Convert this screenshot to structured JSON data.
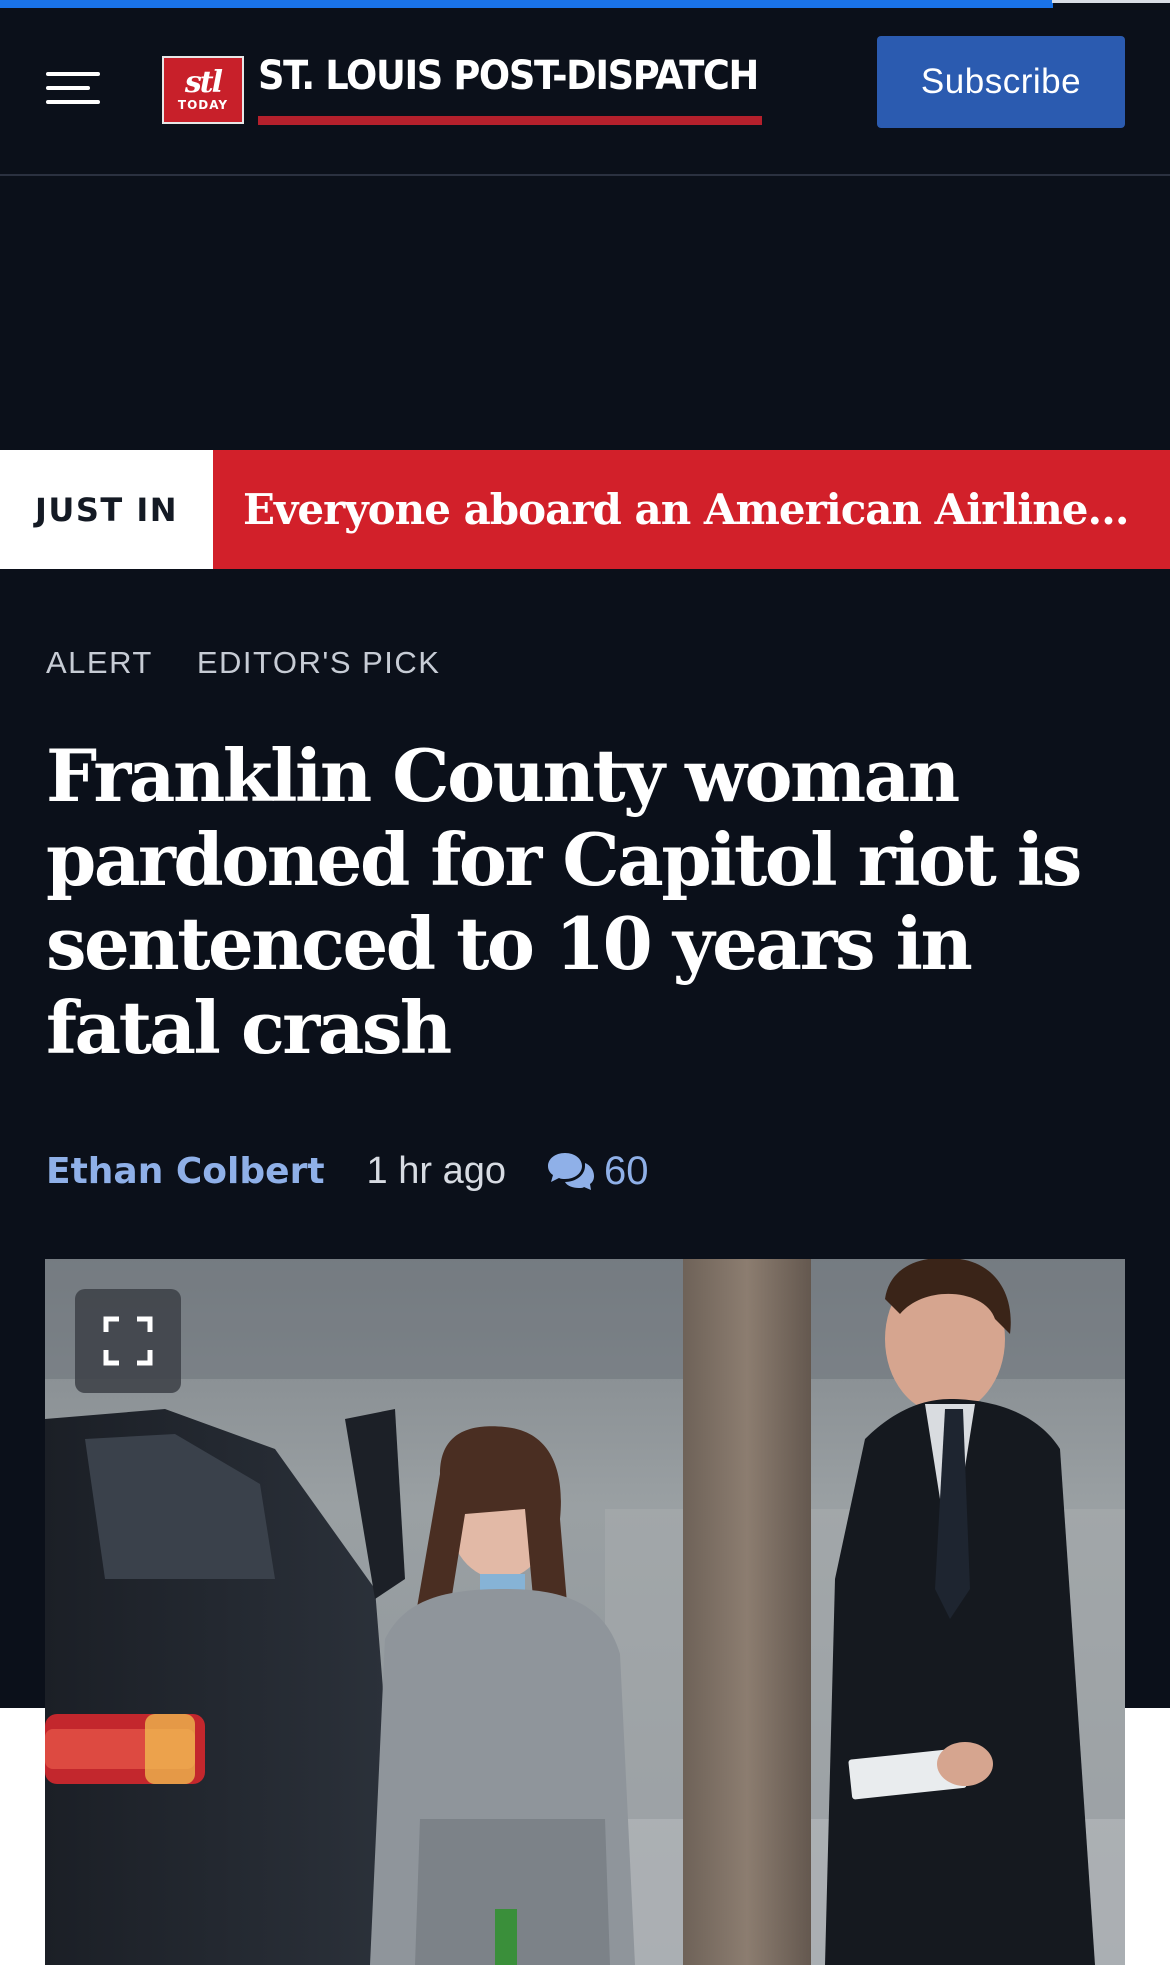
{
  "progress": {
    "fraction": 0.9
  },
  "header": {
    "logo_badge_mark": "stl",
    "logo_badge_sub": "TODAY",
    "logo_text": "ST. LOUIS POST-DISPATCH",
    "subscribe_label": "Subscribe"
  },
  "just_in": {
    "label": "JUST IN",
    "headline": "Everyone aboard an American Airlines jet th..."
  },
  "tags": [
    "ALERT",
    "EDITOR'S PICK"
  ],
  "article": {
    "headline": "Franklin County woman pardoned for Capitol riot is sentenced to 10 years in fatal crash",
    "author": "Ethan Colbert",
    "time": "1 hr ago",
    "comment_count": "60"
  },
  "colors": {
    "background": "#0b101a",
    "accent_blue": "#2b5bb0",
    "brand_red": "#d2202a",
    "link_blue": "#8fb0e8"
  },
  "icons": {
    "menu": "hamburger-menu-icon",
    "comments": "chat-bubbles-icon",
    "expand": "fullscreen-expand-icon"
  }
}
